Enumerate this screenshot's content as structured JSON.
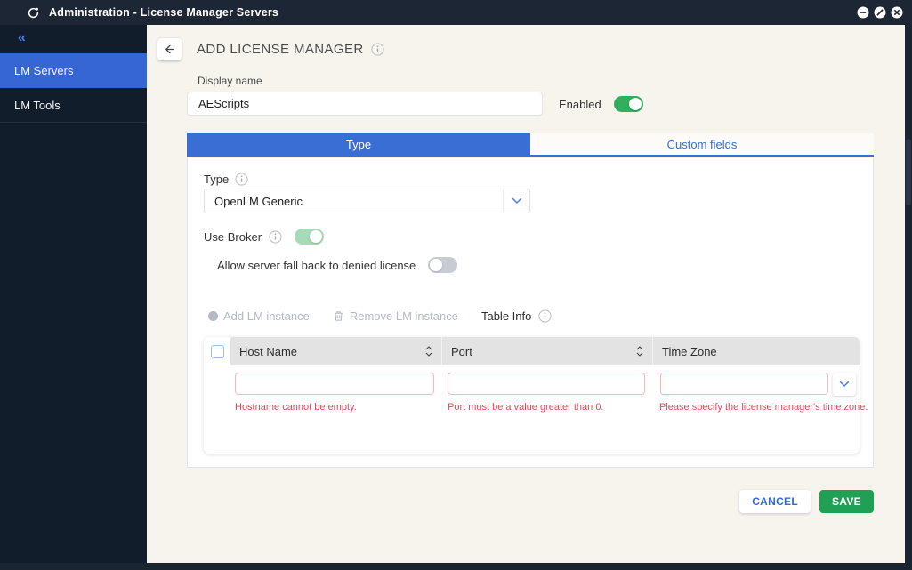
{
  "window": {
    "title": "Administration - License Manager Servers",
    "controls": {
      "minimize": "minimize",
      "maximize": "maximize-disabled",
      "close": "close"
    }
  },
  "sidebar": {
    "collapse_icon": "«",
    "items": [
      {
        "label": "LM Servers",
        "selected": true
      },
      {
        "label": "LM Tools",
        "selected": false
      }
    ]
  },
  "header": {
    "title": "ADD LICENSE MANAGER"
  },
  "form": {
    "display_name_label": "Display name",
    "display_name_value": "AEScripts",
    "enabled_label": "Enabled",
    "enabled_state": "on"
  },
  "tabs": [
    {
      "label": "Type",
      "active": true
    },
    {
      "label": "Custom fields",
      "active": false
    }
  ],
  "type_section": {
    "type_label": "Type",
    "type_value": "OpenLM Generic",
    "use_broker_label": "Use Broker",
    "use_broker_state": "on",
    "fallback_label": "Allow server fall back to denied license",
    "fallback_state": "off"
  },
  "toolbar": {
    "add_label": "Add LM instance",
    "remove_label": "Remove LM instance",
    "table_info_label": "Table Info"
  },
  "table": {
    "columns": [
      "Host Name",
      "Port",
      "Time Zone"
    ],
    "row": {
      "host_value": "",
      "port_value": "",
      "timezone_value": "",
      "host_error": "Hostname cannot be empty.",
      "port_error": "Port must be a value greater than 0.",
      "timezone_error": "Please specify the license manager's time zone."
    }
  },
  "actions": {
    "cancel_label": "CANCEL",
    "save_label": "SAVE"
  },
  "colors": {
    "titlebar": "#1c2634",
    "sidebar_bg": "#121d2b",
    "selected_blue": "#3566d3",
    "tab_blue": "#3a6ed5",
    "content_bg": "#f7f4ee",
    "toggle_green": "#34ad5c",
    "toggle_light_green": "#a6dab8",
    "toggle_off_gray": "#c8ccd2",
    "error_red": "#e8475c",
    "error_border_pink": "#f4b7c0",
    "table_header_gray": "#e3e3e3",
    "save_green": "#1fa055",
    "cancel_text_blue": "#2e6bd6"
  }
}
